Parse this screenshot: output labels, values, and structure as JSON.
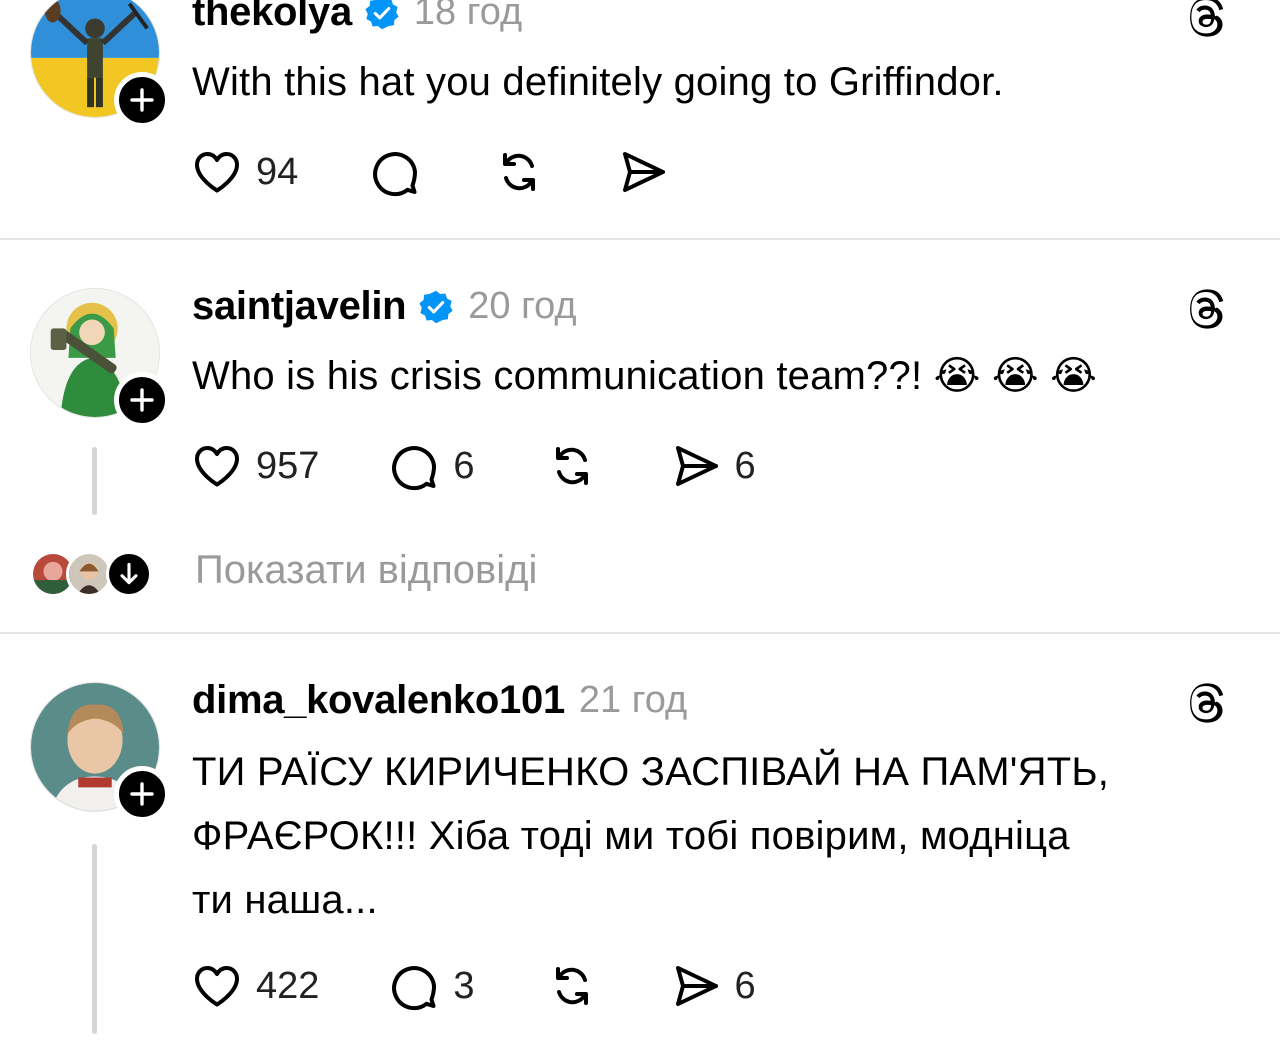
{
  "posts": [
    {
      "username": "thekolya",
      "time": "18 год",
      "text": "With this hat you definitely going to Griffindor.",
      "likes": "94",
      "comments": "",
      "shares": ""
    },
    {
      "username": "saintjavelin",
      "time": "20 год",
      "text": "Who is his crisis communication team??! 😭 😭 😭",
      "likes": "957",
      "comments": "6",
      "shares": "6"
    },
    {
      "username": "dima_kovalenko101",
      "time": "21 год",
      "text_lines": [
        "ТИ РАЇСУ КИРИЧЕНКО ЗАСПІВАЙ НА ПАМ'ЯТЬ,",
        "ФРАЄРОК!!! Хіба тоді ми тобі повірим, модніца",
        "ти наша..."
      ],
      "likes": "422",
      "comments": "3",
      "shares": "6"
    }
  ],
  "show_replies_label": "Показати відповіді",
  "colors": {
    "verified": "#0095f6",
    "muted_text": "#9a9a9a",
    "divider": "#e5e5e5"
  },
  "icons": [
    "heart-icon",
    "comment-icon",
    "repost-icon",
    "share-icon",
    "threads-logo-icon",
    "verified-badge-icon",
    "follow-plus-icon",
    "expand-arrow-icon"
  ]
}
